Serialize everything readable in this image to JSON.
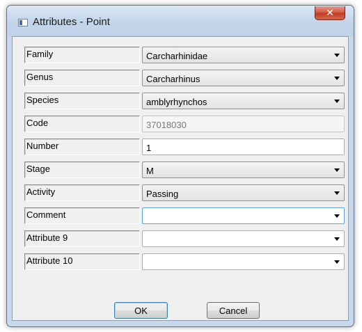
{
  "window": {
    "title": "Attributes - Point",
    "close_glyph": "✕"
  },
  "fields": [
    {
      "label": "Family",
      "value": "Carcharhinidae",
      "kind": "combo"
    },
    {
      "label": "Genus",
      "value": "Carcharhinus",
      "kind": "combo"
    },
    {
      "label": "Species",
      "value": "amblyrhynchos",
      "kind": "combo"
    },
    {
      "label": "Code",
      "value": "37018030",
      "kind": "readonly"
    },
    {
      "label": "Number",
      "value": "1",
      "kind": "text"
    },
    {
      "label": "Stage",
      "value": "M",
      "kind": "combo"
    },
    {
      "label": "Activity",
      "value": "Passing",
      "kind": "combo"
    },
    {
      "label": "Comment",
      "value": "",
      "kind": "combo-focused"
    },
    {
      "label": "Attribute 9",
      "value": "",
      "kind": "combo-empty"
    },
    {
      "label": "Attribute 10",
      "value": "",
      "kind": "combo-empty"
    }
  ],
  "buttons": {
    "ok": "OK",
    "cancel": "Cancel"
  }
}
